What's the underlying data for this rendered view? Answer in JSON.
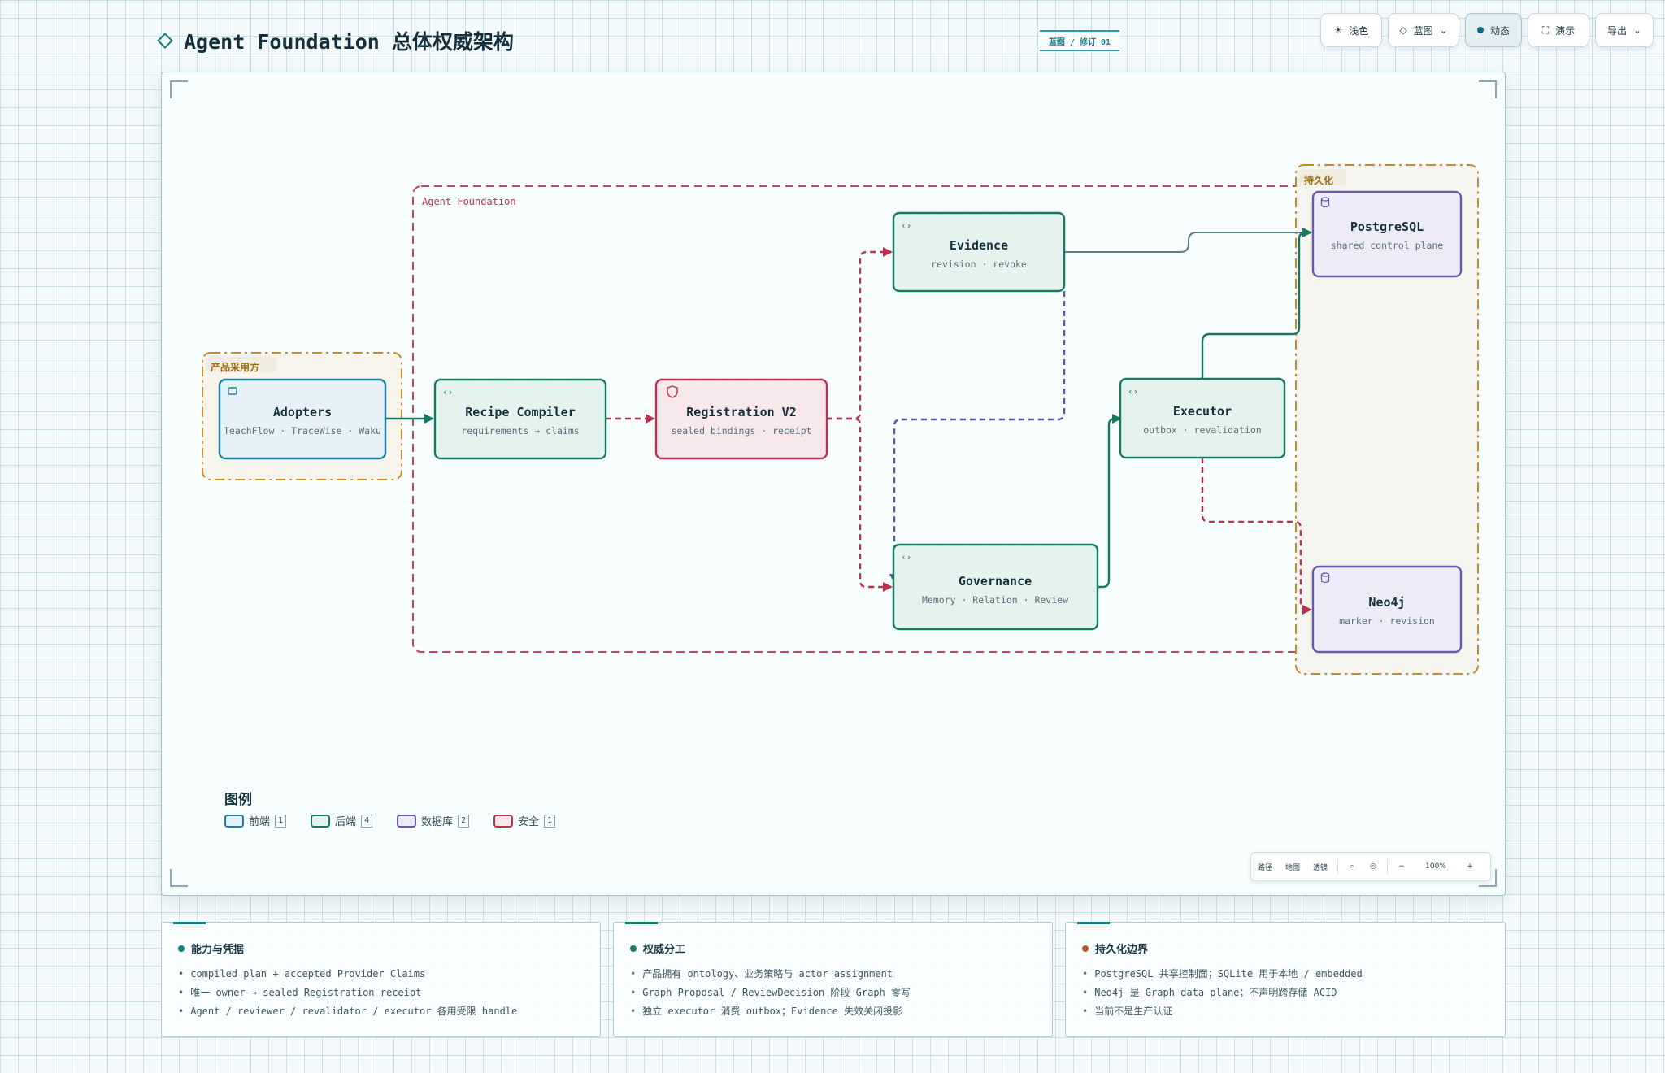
{
  "header": {
    "title": "Agent Foundation 总体权威架构",
    "badge": "蓝图 / 修订 01"
  },
  "toolbar": {
    "light": "浅色",
    "blueprint": "蓝图",
    "dynamic": "动态",
    "present": "演示",
    "export": "导出"
  },
  "groups": {
    "adopters_group": "产品采用方",
    "foundation_group": "Agent Foundation",
    "persistence_group": "持久化"
  },
  "nodes": {
    "adopters": {
      "title": "Adopters",
      "subtitle": "TeachFlow · TraceWise · Waku"
    },
    "recipe": {
      "title": "Recipe Compiler",
      "subtitle": "requirements → claims"
    },
    "registration": {
      "title": "Registration V2",
      "subtitle": "sealed bindings · receipt"
    },
    "evidence": {
      "title": "Evidence",
      "subtitle": "revision · revoke"
    },
    "governance": {
      "title": "Governance",
      "subtitle": "Memory · Relation · Review"
    },
    "executor": {
      "title": "Executor",
      "subtitle": "outbox · revalidation"
    },
    "postgres": {
      "title": "PostgreSQL",
      "subtitle": "shared control plane"
    },
    "neo4j": {
      "title": "Neo4j",
      "subtitle": "marker · revision"
    }
  },
  "legend": {
    "title": "图例",
    "items": [
      {
        "label": "前端",
        "count": "1",
        "color": "#1b7ea3",
        "fill": "#e6f2f7"
      },
      {
        "label": "后端",
        "count": "4",
        "color": "#147a63",
        "fill": "#e5f3ef"
      },
      {
        "label": "数据库",
        "count": "2",
        "color": "#6a58ad",
        "fill": "#eeebf8"
      },
      {
        "label": "安全",
        "count": "1",
        "color": "#b8324f",
        "fill": "#f8e8ec"
      }
    ]
  },
  "mapbar": {
    "path": "路径",
    "map": "地图",
    "transparent": "透镜",
    "zoom": "100%",
    "minus": "−",
    "plus": "+"
  },
  "cards": [
    {
      "title": "能力与凭据",
      "dot": "#0f7b83",
      "items": [
        "compiled plan + accepted Provider Claims",
        "唯一 owner → sealed Registration receipt",
        "Agent / reviewer / revalidator / executor 各用受限 handle"
      ]
    },
    {
      "title": "权威分工",
      "dot": "#147a63",
      "items": [
        "产品拥有 ontology、业务策略与 actor assignment",
        "Graph Proposal / ReviewDecision 阶段 Graph 零写",
        "独立 executor 消费 outbox；Evidence 失效关闭投影"
      ]
    },
    {
      "title": "持久化边界",
      "dot": "#b45a2a",
      "items": [
        "PostgreSQL 共享控制面；SQLite 用于本地 / embedded",
        "Neo4j 是 Graph data plane；不声明跨存储 ACID",
        "当前不是生产认证"
      ]
    }
  ],
  "colors": {
    "frontend": "#1b7ea3",
    "backend": "#147a63",
    "database": "#6a58ad",
    "security": "#b8324f",
    "group_orange": "#c98a2c"
  }
}
